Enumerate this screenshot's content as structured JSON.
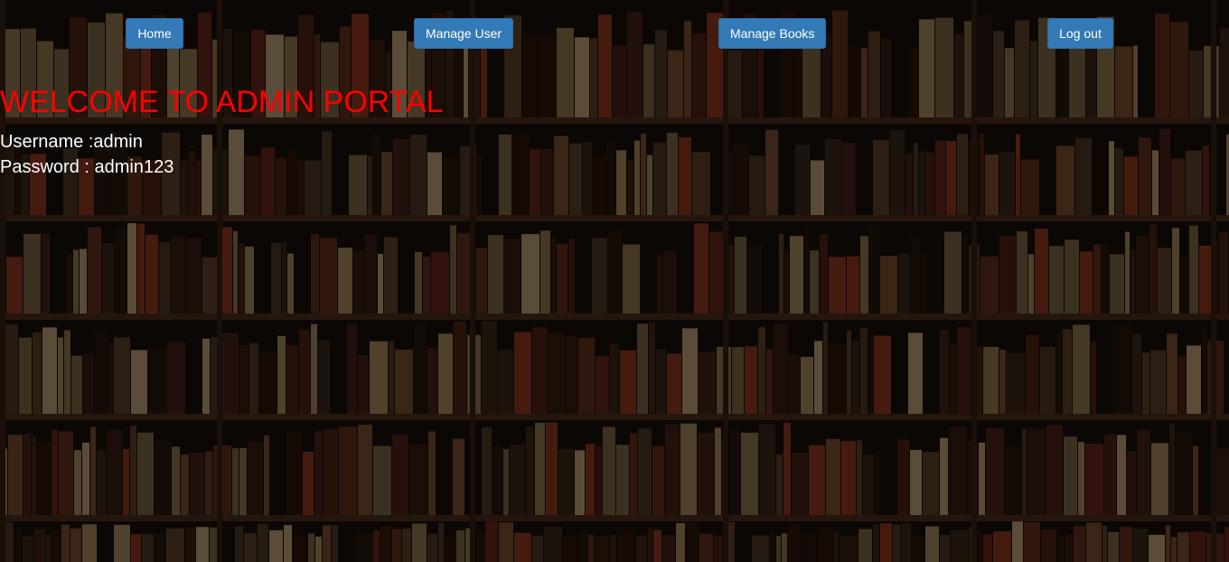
{
  "nav": {
    "home": "Home",
    "manage_user": "Manage User",
    "manage_books": "Manage Books",
    "logout": "Log out",
    "button_color": "#337ab7"
  },
  "main": {
    "heading": "WELCOME TO ADMIN PORTAL",
    "heading_color": "#ff0000",
    "username_line": "Username :admin",
    "password_line": "Password : admin123"
  },
  "background": {
    "subject": "dark bookshelf wall",
    "base_color": "#120c08"
  }
}
